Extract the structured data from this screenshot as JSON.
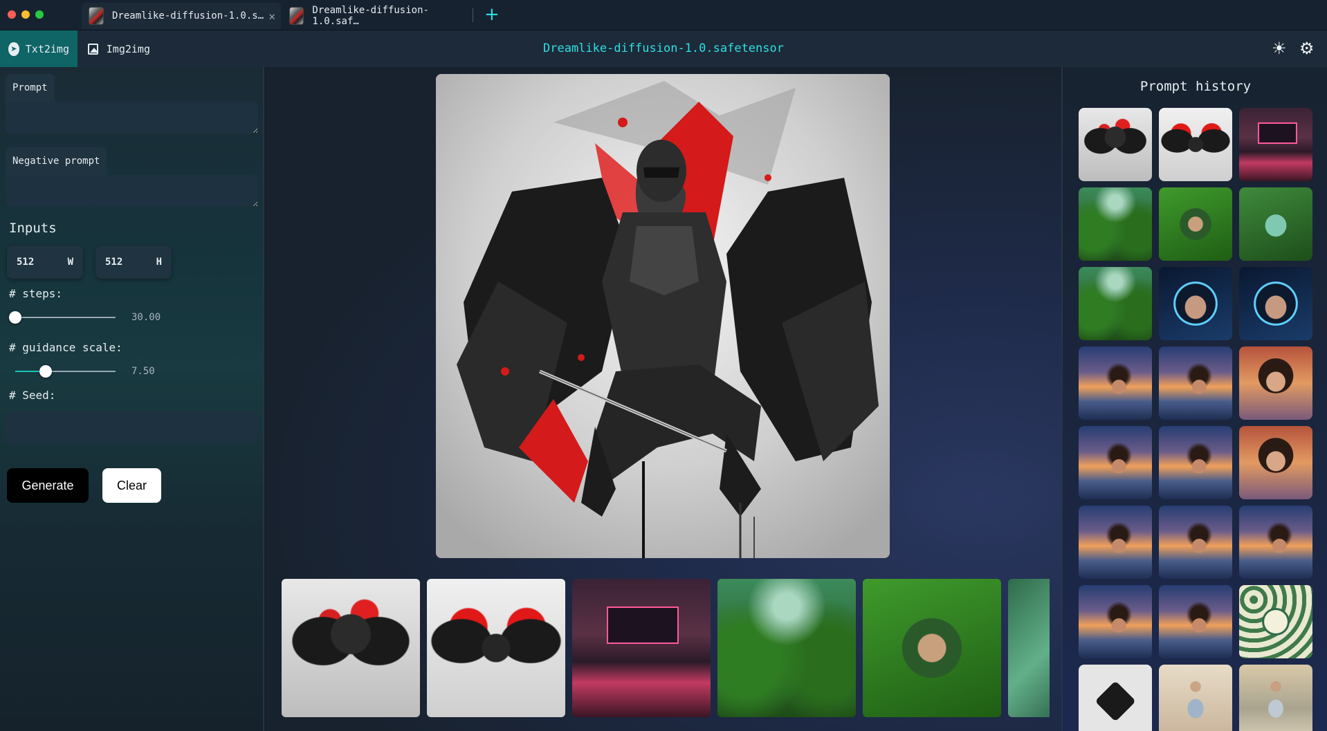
{
  "window": {
    "tabs": [
      {
        "title": "Dreamlike-diffusion-1.0.s…",
        "active": true
      },
      {
        "title": "Dreamlike-diffusion-1.0.saf…",
        "active": false
      }
    ],
    "new_tab_label": "+",
    "close_glyph": "✕"
  },
  "header": {
    "modes": [
      {
        "label": "Txt2img",
        "icon": "send-icon",
        "active": true
      },
      {
        "label": "Img2img",
        "icon": "image-icon",
        "active": false
      }
    ],
    "title": "Dreamlike-diffusion-1.0.safetensor",
    "theme_icon_glyph": "☀",
    "settings_icon_glyph": "⚙",
    "accent_color": "#2fe0e0"
  },
  "form": {
    "prompt_label": "Prompt",
    "prompt_value": "",
    "negative_prompt_label": "Negative prompt",
    "negative_prompt_value": "",
    "inputs_title": "Inputs",
    "width_value": "512",
    "width_unit": "W",
    "height_value": "512",
    "height_unit": "H",
    "steps_label": "# steps:",
    "steps_value": "30.00",
    "steps_fraction": 0.0,
    "guidance_label": "# guidance scale:",
    "guidance_value": "7.50",
    "guidance_fraction": 0.3,
    "seed_label": "# Seed:",
    "seed_value": "",
    "generate_label": "Generate",
    "clear_label": "Clear"
  },
  "history": {
    "title": "Prompt history",
    "items": [
      "knight",
      "angel",
      "room",
      "jungle",
      "face-green",
      "face-teal",
      "jungle",
      "neon-face",
      "neon-face",
      "beach",
      "beach",
      "portrait",
      "beach",
      "beach",
      "portrait",
      "beach",
      "beach",
      "beach",
      "beach",
      "beach",
      "leaf",
      "logo",
      "dress",
      "sea-dress"
    ]
  },
  "carousel": {
    "items": [
      "knight",
      "angel",
      "room",
      "jungle",
      "face-green",
      "leaves-edge"
    ]
  }
}
